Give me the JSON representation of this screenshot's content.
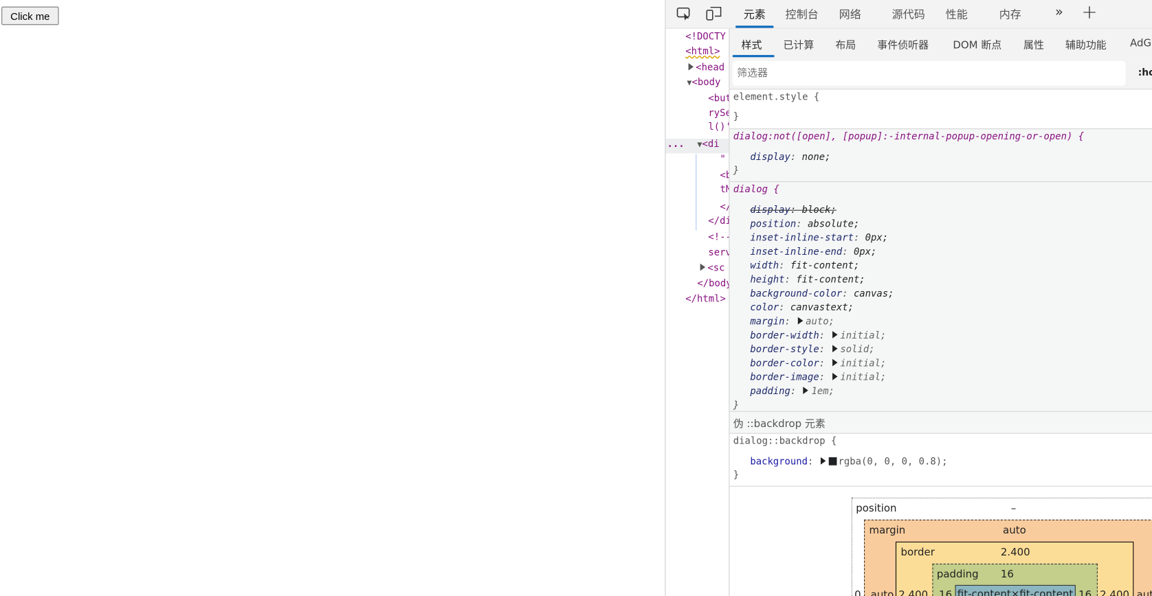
{
  "page": {
    "button_label": "Click me"
  },
  "devtools": {
    "main_tabs": [
      "元素",
      "控制台",
      "网络",
      "源代码",
      "性能",
      "内存"
    ],
    "more_tabs": "»",
    "add_tab": "+",
    "elements_tree": [
      "<!DOCTY",
      "<html>",
      "<head",
      "<body",
      "<but",
      "rySe",
      "l()'",
      "<di",
      "\"",
      "<b",
      "tM",
      "</",
      "</di",
      "<!--",
      "serv",
      "<sc",
      "</body",
      "</html>"
    ],
    "selected_row_marker": "...",
    "sub_tabs": [
      "样式",
      "已计算",
      "布局",
      "事件侦听器",
      "DOM 断点",
      "属性",
      "辅助功能",
      "AdG"
    ],
    "filter_placeholder": "筛选器",
    "hov_button": ":ho",
    "rules": {
      "element_style": {
        "selector": "element.style {",
        "close": "}"
      },
      "dialog_not": {
        "selector": "dialog:not([open], [popup]:-internal-popup-opening-or-open) {",
        "props": [
          {
            "name": "display",
            "value": "none;"
          }
        ],
        "close": "}"
      },
      "dialog": {
        "selector": "dialog {",
        "props": [
          {
            "name": "display",
            "value": "block;"
          },
          {
            "name": "position",
            "value": "absolute;"
          },
          {
            "name": "inset-inline-start",
            "value": "0px;"
          },
          {
            "name": "inset-inline-end",
            "value": "0px;"
          },
          {
            "name": "width",
            "value": "fit-content;"
          },
          {
            "name": "height",
            "value": "fit-content;"
          },
          {
            "name": "background-color",
            "value": "canvas;"
          },
          {
            "name": "color",
            "value": "canvastext;"
          },
          {
            "name": "margin",
            "value": "auto;"
          },
          {
            "name": "border-width",
            "value": "initial;"
          },
          {
            "name": "border-style",
            "value": "solid;"
          },
          {
            "name": "border-color",
            "value": "initial;"
          },
          {
            "name": "border-image",
            "value": "initial;"
          },
          {
            "name": "padding",
            "value": "1em;"
          }
        ],
        "close": "}"
      },
      "pseudo_header": "伪 ::backdrop 元素",
      "backdrop": {
        "selector": "dialog::backdrop {",
        "props": [
          {
            "name": "background",
            "value": "rgba(0, 0, 0, 0.8);",
            "swatch": "#202124"
          }
        ],
        "close": "}"
      }
    },
    "box_model": {
      "position_label": "position",
      "position_value": "–",
      "position_left": "0",
      "margin_label": "margin",
      "margin_top": "auto",
      "margin_left": "auto",
      "margin_right": "auto",
      "border_label": "border",
      "border_top": "2.400",
      "border_left": "2.400",
      "border_right": "2.400",
      "padding_label": "padding",
      "padding_top": "16",
      "padding_left": "16",
      "padding_right": "16",
      "content": "fit-content×fit-content"
    },
    "colors": {
      "accent": "#0f6cbd",
      "margin": "#f9cc9d",
      "border": "#fcdd97",
      "padding": "#c3cf8a",
      "content": "#8cb6c0"
    }
  }
}
